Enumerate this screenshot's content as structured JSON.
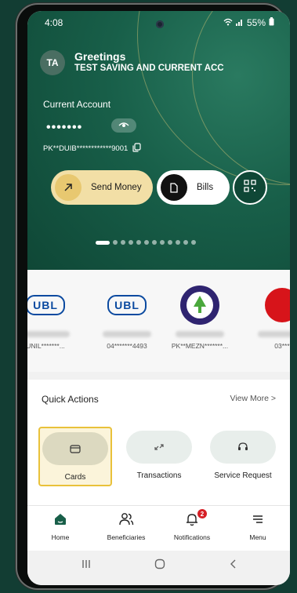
{
  "status_bar": {
    "time": "4:08",
    "battery": "55%"
  },
  "header": {
    "avatar_initials": "TA",
    "greeting": "Greetings",
    "account_name": "TEST SAVING AND CURRENT ACC"
  },
  "account": {
    "type_label": "Current Account",
    "masked_balance": "•••••••",
    "account_number": "PK**DUIB************9001"
  },
  "actions": {
    "send_money": "Send Money",
    "bills": "Bills"
  },
  "carousel": {
    "total_pages": 12,
    "active_index": 0
  },
  "beneficiaries": [
    {
      "bank": "UBL",
      "account": "UNIL*******..."
    },
    {
      "bank": "UBL",
      "account": "04*******4493"
    },
    {
      "bank": "MEEZAN BANK",
      "account": "PK**MEZN*******..."
    },
    {
      "bank": "",
      "account": "03***"
    }
  ],
  "quick_actions": {
    "title": "Quick Actions",
    "view_more": "View More >",
    "items": [
      {
        "label": "Cards",
        "icon": "card-icon",
        "active": true
      },
      {
        "label": "Transactions",
        "icon": "transfer-icon",
        "active": false
      },
      {
        "label": "Service Request",
        "icon": "headset-icon",
        "active": false
      }
    ]
  },
  "bottom_nav": [
    {
      "label": "Home",
      "icon": "home-icon"
    },
    {
      "label": "Beneficiaries",
      "icon": "users-icon"
    },
    {
      "label": "Notifications",
      "icon": "bell-icon",
      "badge": "2"
    },
    {
      "label": "Menu",
      "icon": "menu-icon"
    }
  ],
  "colors": {
    "brand_green": "#185f49",
    "accent_gold": "#f2dfa6",
    "badge_red": "#d61f26"
  }
}
